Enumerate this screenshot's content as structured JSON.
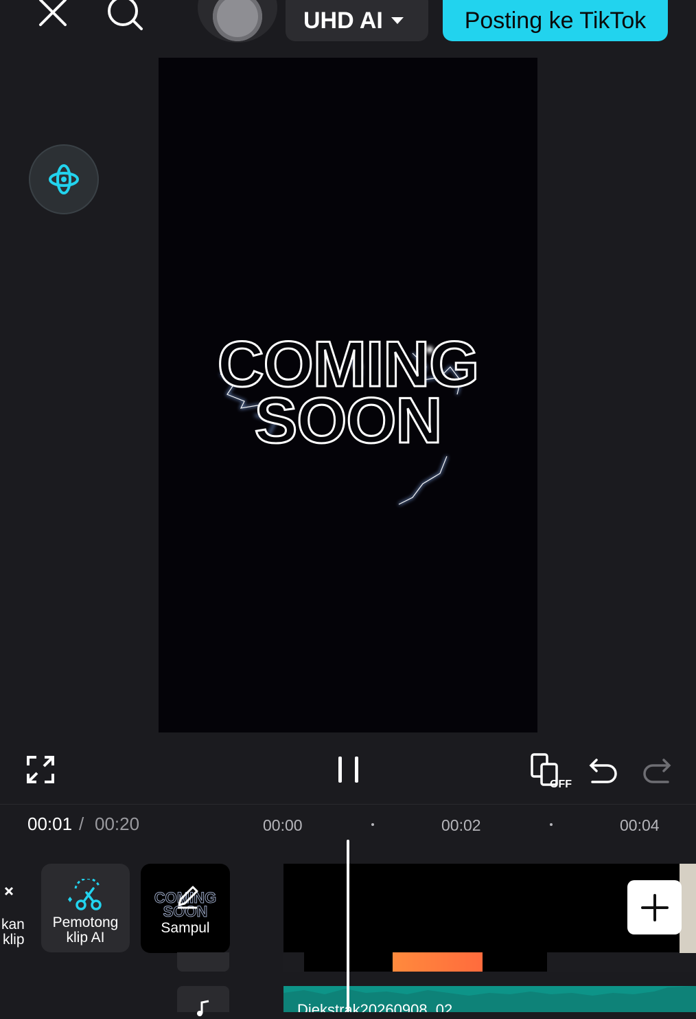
{
  "topbar": {
    "quality_label": "UHD AI",
    "post_label": "Posting ke TikTok",
    "close_icon": "close-icon",
    "search_icon": "search-icon"
  },
  "preview": {
    "line1": "COMING",
    "line2": "SOON"
  },
  "controls": {
    "fullscreen_icon": "fullscreen-icon",
    "pause_icon": "pause-icon",
    "keyframe_icon": "keyframe-off-icon",
    "keyframe_state": "OFF",
    "undo_icon": "undo-icon",
    "redo_icon": "redo-icon"
  },
  "timeline": {
    "current": "00:01",
    "separator": "/",
    "total": "00:20",
    "ticks": [
      "00:00",
      "00:02",
      "00:04"
    ]
  },
  "tools": {
    "partial_label_1": "kan",
    "partial_label_2": "klip",
    "ai_cutter_line1": "Pemotong",
    "ai_cutter_line2": "klip AI",
    "cover_label": "Sampul",
    "cover_thumb_text1": "COMING",
    "cover_thumb_text2": "SOON"
  },
  "audio": {
    "label": "Diekstrak20260908_02"
  },
  "colors": {
    "accent": "#22d3ee",
    "audio_track": "#0d9488",
    "clip_marker": "#ff8a3d"
  }
}
